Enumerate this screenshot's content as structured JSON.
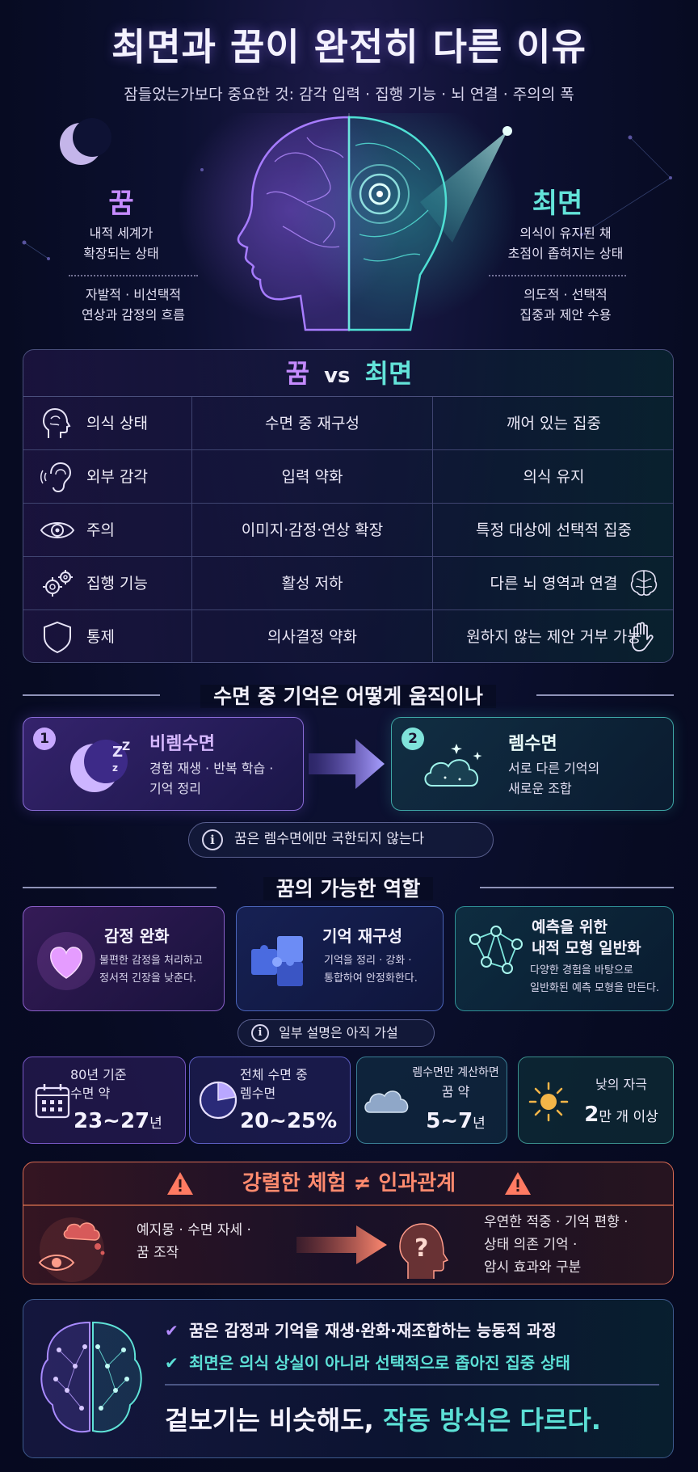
{
  "header": {
    "title": "최면과 꿈이 완전히 다른 이유",
    "subtitle": "잠들었는가보다 중요한 것: 감각 입력 · 집행 기능 · 뇌 연결 · 주의의 폭"
  },
  "hero": {
    "dream": {
      "title": "꿈",
      "desc1": "내적 세계가",
      "desc2": "확장되는 상태",
      "detail1": "자발적 · 비선택적",
      "detail2": "연상과 감정의 흐름"
    },
    "hypnosis": {
      "title": "최면",
      "desc1": "의식이 유지된 채",
      "desc2": "초점이 좁혀지는 상태",
      "detail1": "의도적 · 선택적",
      "detail2": "집중과 제안 수용"
    }
  },
  "compare": {
    "head_dream": "꿈",
    "head_vs": "vs",
    "head_hypnosis": "최면",
    "rows": [
      {
        "label": "의식 상태",
        "dream": "수면 중 재구성",
        "hypnosis": "깨어 있는 집중",
        "icon": "head-brain-icon"
      },
      {
        "label": "외부 감각",
        "dream": "입력 약화",
        "hypnosis": "의식 유지",
        "icon": "ear-icon"
      },
      {
        "label": "주의",
        "dream": "이미지·감정·연상 확장",
        "hypnosis": "특정 대상에 선택적 집중",
        "icon": "eye-icon"
      },
      {
        "label": "집행 기능",
        "dream": "활성 저하",
        "hypnosis": "다른 뇌 영역과 연결",
        "icon": "gears-icon"
      },
      {
        "label": "통제",
        "dream": "의사결정 약화",
        "hypnosis": "원하지 않는 제안 거부 가능",
        "icon": "shield-icon"
      }
    ]
  },
  "memory": {
    "heading": "수면 중 기억은 어떻게 움직이나",
    "nrem": {
      "num": "1",
      "title": "비렘수면",
      "desc1": "경험 재생 · 반복 학습 ·",
      "desc2": "기억 정리"
    },
    "rem": {
      "num": "2",
      "title": "렘수면",
      "desc1": "서로 다른 기억의",
      "desc2": "새로운 조합"
    },
    "note": "꿈은 렘수면에만 국한되지 않는다"
  },
  "roles": {
    "heading": "꿈의 가능한 역할",
    "items": [
      {
        "title": "감정 완화",
        "desc1": "불편한 감정을 처리하고",
        "desc2": "정서적 긴장을 낮춘다."
      },
      {
        "title": "기억 재구성",
        "desc1": "기억을 정리 · 강화 ·",
        "desc2": "통합하여 안정화한다."
      },
      {
        "title1": "예측을 위한",
        "title2": "내적 모형 일반화",
        "desc1": "다양한 경험을 바탕으로",
        "desc2": "일반화된 예측 모형을 만든다."
      }
    ],
    "note": "일부 설명은 아직 가설"
  },
  "stats": [
    {
      "line1": "80년 기준",
      "line2": "수면 약",
      "value": "23~27",
      "unit": "년"
    },
    {
      "line1": "전체 수면 중",
      "line2": "렘수면",
      "value": "20~25%",
      "unit": ""
    },
    {
      "line1": "렘수면만 계산하면",
      "line2": "꿈 약",
      "value": "5~7",
      "unit": "년"
    },
    {
      "line1": "낮의 자극",
      "line2": "",
      "value": "2",
      "unit": "만 개 이상"
    }
  ],
  "warning": {
    "title": "강렬한 체험 ≠ 인과관계",
    "left1": "예지몽 · 수면 자세 ·",
    "left2": "꿈 조작",
    "right1": "우연한 적중 · 기억 편향 ·",
    "right2": "상태 의존 기억 ·",
    "right3": "암시 효과와 구분",
    "question": "?"
  },
  "summary": {
    "check1": "꿈은 감정과 기억을 재생·완화·재조합하는 능동적 과정",
    "check2": "최면은 의식 상실이 아니라 선택적으로 좁아진 집중 상태",
    "conclusion_a": "겉보기는 비슷해도, ",
    "conclusion_b": "작동 방식은 다르다."
  },
  "colors": {
    "dream_accent": "#c58bff",
    "hypnosis_accent": "#63e3d9",
    "warning_accent": "#ff8a6e",
    "background": "#070b22"
  }
}
